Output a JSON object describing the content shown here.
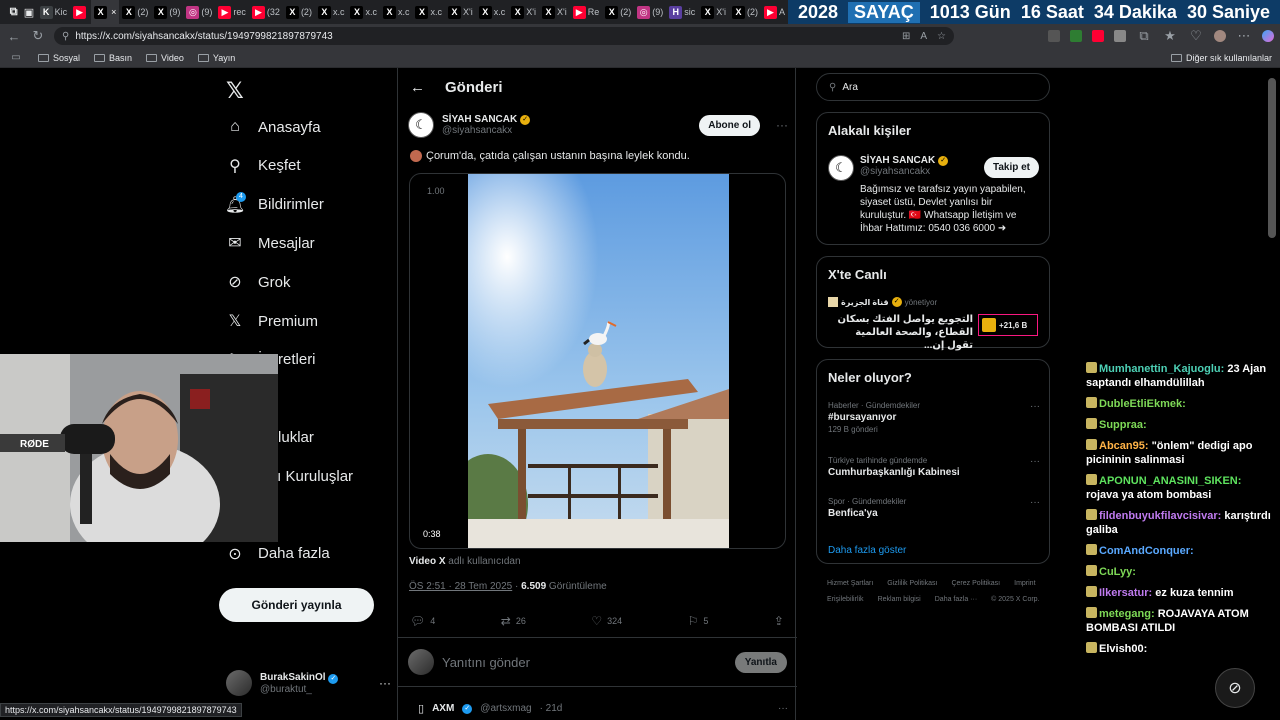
{
  "browser": {
    "tabs": [
      {
        "label": "Kic",
        "fav": "K",
        "color": "#3c4043"
      },
      {
        "label": "",
        "fav": "▶",
        "color": "#ff0033"
      },
      {
        "label": "",
        "fav": "X",
        "color": "#000000",
        "active": true
      },
      {
        "label": "(2)",
        "fav": "X",
        "color": "#000000"
      },
      {
        "label": "(9)",
        "fav": "X",
        "color": "#000000"
      },
      {
        "label": "(9)",
        "fav": "◎",
        "color": "#c13584"
      },
      {
        "label": "rec",
        "fav": "▶",
        "color": "#ff0033"
      },
      {
        "label": "(32",
        "fav": "▶",
        "color": "#ff0033"
      },
      {
        "label": "(2)",
        "fav": "X",
        "color": "#000000"
      },
      {
        "label": "x.c",
        "fav": "X",
        "color": "#000000"
      },
      {
        "label": "x.c",
        "fav": "X",
        "color": "#000000"
      },
      {
        "label": "x.c",
        "fav": "X",
        "color": "#000000"
      },
      {
        "label": "x.c",
        "fav": "X",
        "color": "#000000"
      },
      {
        "label": "X'i",
        "fav": "X",
        "color": "#000000"
      },
      {
        "label": "x.c",
        "fav": "X",
        "color": "#000000"
      },
      {
        "label": "X'i",
        "fav": "X",
        "color": "#000000"
      },
      {
        "label": "X'i",
        "fav": "X",
        "color": "#000000"
      },
      {
        "label": "Re",
        "fav": "▶",
        "color": "#ff0033"
      },
      {
        "label": "(2)",
        "fav": "X",
        "color": "#000000"
      },
      {
        "label": "(9)",
        "fav": "◎",
        "color": "#c13584"
      },
      {
        "label": "sic",
        "fav": "H",
        "color": "#5a3fa0"
      },
      {
        "label": "X'i",
        "fav": "X",
        "color": "#000000"
      },
      {
        "label": "(2)",
        "fav": "X",
        "color": "#000000"
      },
      {
        "label": "A",
        "fav": "▶",
        "color": "#ff0033"
      }
    ],
    "counter": {
      "year": "2028",
      "label": "SAYAÇ",
      "days": "1013 Gün",
      "hours": "16 Saat",
      "minutes": "34 Dakika",
      "seconds": "30 Saniye"
    },
    "url": "https://x.com/siyahsancakx/status/1949799821897879743",
    "bookmarks": [
      "Sosyal",
      "Basın",
      "Video",
      "Yayın"
    ],
    "other_bookmarks": "Diğer sık kullanılanlar",
    "status_url": "https://x.com/siyahsancakx/status/1949799821897879743"
  },
  "sidebar": {
    "items": [
      {
        "label": "Anasayfa",
        "icon": "home-icon"
      },
      {
        "label": "Keşfet",
        "icon": "search-icon"
      },
      {
        "label": "Bildirimler",
        "icon": "bell-icon",
        "badge": "4"
      },
      {
        "label": "Mesajlar",
        "icon": "mail-icon"
      },
      {
        "label": "Grok",
        "icon": "grok-icon"
      },
      {
        "label": "Premium",
        "icon": "x-logo-icon"
      },
      {
        "label": "İşaretleri",
        "icon": "bookmark-icon"
      },
      {
        "label": "r",
        "icon": "list-icon"
      },
      {
        "label": "oluluklar",
        "icon": "communities-icon"
      },
      {
        "label": "aylı Kuruluşlar",
        "icon": "verified-orgs-icon"
      },
      {
        "label": "fil",
        "icon": "profile-icon"
      },
      {
        "label": "Daha fazla",
        "icon": "more-circle-icon"
      }
    ],
    "post_button": "Gönderi yayınla",
    "account": {
      "name": "BurakSakinOl",
      "handle": "@buraktut_"
    }
  },
  "main": {
    "title": "Gönderi",
    "author": {
      "name": "SİYAH SANCAK",
      "handle": "@siyahsancakx"
    },
    "subscribe": "Abone ol",
    "text": "Çorum'da, çatıda çalışan ustanın başına leylek kondu.",
    "video": {
      "speed": "1.00",
      "duration": "0:38"
    },
    "video_from_name": "Video X",
    "video_from_suffix": " adlı kullanıcıdan",
    "timestamp": "ÖS 2:51 · 28 Tem 2025",
    "views": "6.509",
    "views_label": "Görüntüleme",
    "stats": {
      "replies": "4",
      "reposts": "26",
      "likes": "324",
      "bookmarks": "5"
    },
    "reply_placeholder": "Yanıtını gönder",
    "reply_button": "Yanıtla",
    "next": {
      "name": "AXM",
      "handle": "@artsxmag",
      "time": "· 21d"
    }
  },
  "right": {
    "search_placeholder": "Ara",
    "related": {
      "title": "Alakalı kişiler",
      "name": "SİYAH SANCAK",
      "handle": "@siyahsancakx",
      "follow": "Takip et",
      "bio": "Bağımsız ve tarafsız yayın yapabilen, siyaset üstü, Devlet yanlısı bir kuruluştur. 🇹🇷 Whatsapp İletişim ve İhbar Hattımız: 0540 036 6000 ➜"
    },
    "live": {
      "title": "X'te Canlı",
      "host": "قناة الجزيرة",
      "role": "yönetiyor",
      "text": "التجويع يواصل الفتك بسكان القطاع، والصحة العالمية تقول إن...",
      "count": "+21,6 B"
    },
    "trends": {
      "title": "Neler oluyor?",
      "items": [
        {
          "category": "Haberler · Gündemdekiler",
          "name": "#bursayanıyor",
          "count": "129 B gönderi"
        },
        {
          "category": "Türkiye tarihinde gündemde",
          "name": "Cumhurbaşkanlığı Kabinesi",
          "count": ""
        },
        {
          "category": "Spor · Gündemdekiler",
          "name": "Benfica'ya",
          "count": ""
        }
      ],
      "show_more": "Daha fazla göster"
    },
    "footer": [
      "Hizmet Şartları",
      "Gizlilik Politikası",
      "Çerez Politikası",
      "Imprint",
      "Erişilebilirlik",
      "Reklam bilgisi",
      "Daha fazla ···",
      "© 2025 X Corp."
    ]
  },
  "chat": [
    {
      "user": "Mumhanettin_Kajuoglu:",
      "color": "#4dd0b5",
      "text": "23 Ajan saptandı elhamdülillah"
    },
    {
      "user": "DubleEtliEkmek:",
      "color": "#7ed957",
      "text": ""
    },
    {
      "user": "Suppraa:",
      "color": "#7ed957",
      "text": ""
    },
    {
      "user": "Abcan95:",
      "color": "#ffb347",
      "text": "\"önlem\" dedigi apo picininin salinmasi"
    },
    {
      "user": "APONUN_ANASINI_SIKEN:",
      "color": "#5ee35e",
      "text": "rojava ya atom bombasi"
    },
    {
      "user": "fildenbuyukfilavcisivar:",
      "color": "#c07bf0",
      "text": "karıştırdı galiba"
    },
    {
      "user": "ComAndConquer:",
      "color": "#5aa9ff",
      "text": ""
    },
    {
      "user": "CuLyy:",
      "color": "#7ed957",
      "text": ""
    },
    {
      "user": "Ilkersatur:",
      "color": "#c07bf0",
      "text": "ez kuza tennim"
    },
    {
      "user": "metegang:",
      "color": "#7ed957",
      "text": "ROJAVAYA ATOM BOMBASI ATILDI"
    },
    {
      "user": "Elvish00:",
      "color": "#ffffff",
      "text": ""
    }
  ],
  "webcam": {
    "mic_brand": "RØDE"
  }
}
